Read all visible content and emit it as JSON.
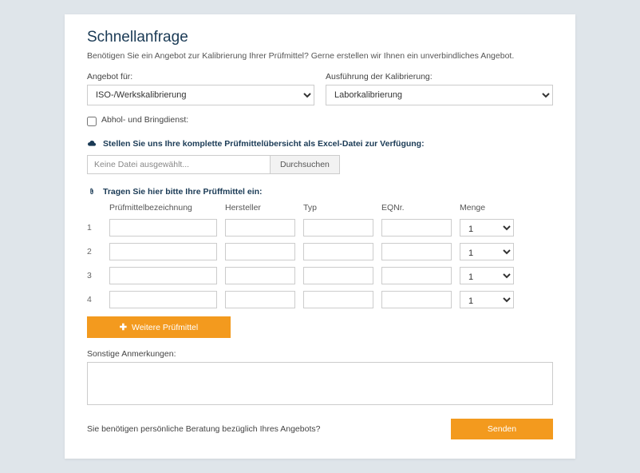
{
  "title": "Schnellanfrage",
  "subtitle": "Benötigen Sie ein Angebot zur Kalibrierung Ihrer Prüfmittel? Gerne erstellen wir Ihnen ein unverbindliches Angebot.",
  "fields": {
    "angebot_label": "Angebot für:",
    "angebot_value": "ISO-/Werkskalibrierung",
    "ausfuehrung_label": "Ausführung der Kalibrierung:",
    "ausfuehrung_value": "Laborkalibrierung",
    "abhol_label": "Abhol- und Bringdienst:"
  },
  "upload": {
    "heading": "Stellen Sie uns Ihre komplette Prüfmittelübersicht als Excel-Datei zur Verfügung:",
    "placeholder": "Keine Datei ausgewählt...",
    "button": "Durchsuchen"
  },
  "table": {
    "heading": "Tragen Sie hier bitte Ihre Prüffmittel ein:",
    "headers": {
      "bez": "Prüfmittelbezeichnung",
      "her": "Hersteller",
      "typ": "Typ",
      "eq": "EQNr.",
      "menge": "Menge"
    },
    "rows": [
      {
        "num": "1",
        "menge": "1"
      },
      {
        "num": "2",
        "menge": "1"
      },
      {
        "num": "3",
        "menge": "1"
      },
      {
        "num": "4",
        "menge": "1"
      }
    ],
    "add_button": "Weitere Prüfmittel"
  },
  "notes_label": "Sonstige Anmerkungen:",
  "send_button": "Senden",
  "help_text": "Sie benötigen persönliche Beratung bezüglich Ihres Angebots?"
}
